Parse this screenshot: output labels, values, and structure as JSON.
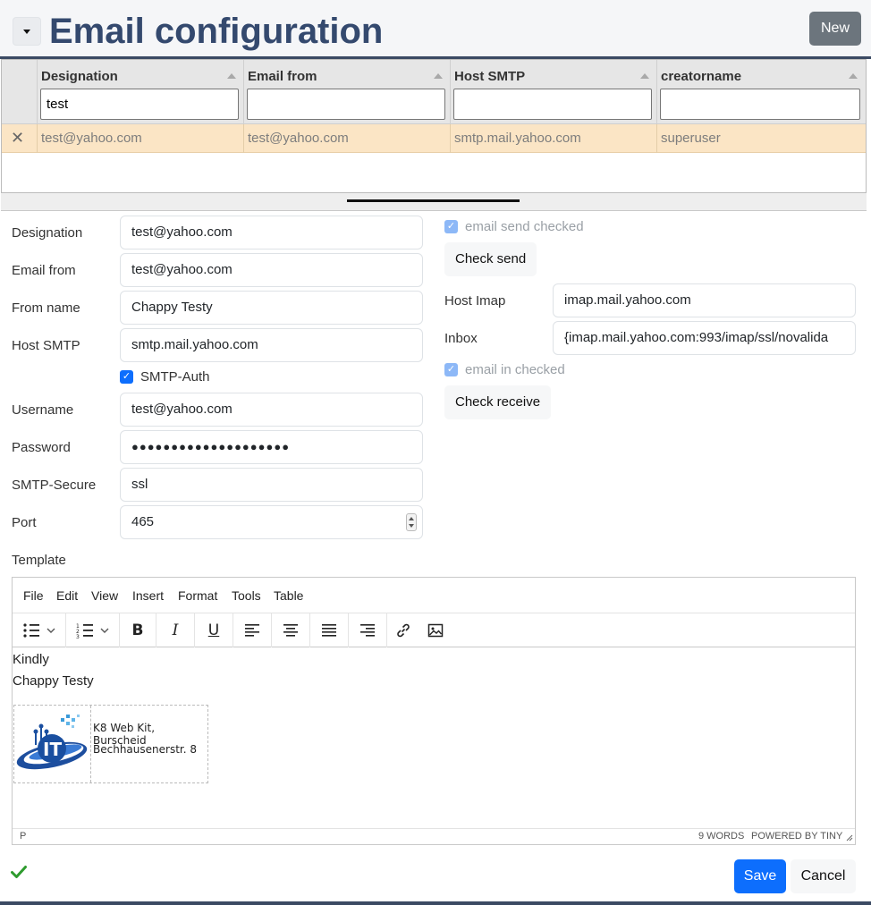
{
  "header": {
    "title": "Email configuration",
    "new_label": "New"
  },
  "grid": {
    "columns": [
      {
        "title": "Designation",
        "filter": "test"
      },
      {
        "title": "Email from",
        "filter": ""
      },
      {
        "title": "Host SMTP",
        "filter": ""
      },
      {
        "title": "creatorname",
        "filter": ""
      }
    ],
    "rows": [
      [
        "test@yahoo.com",
        "test@yahoo.com",
        "smtp.mail.yahoo.com",
        "superuser"
      ]
    ]
  },
  "form": {
    "designation_label": "Designation",
    "designation": "test@yahoo.com",
    "email_from_label": "Email from",
    "email_from": "test@yahoo.com",
    "from_name_label": "From name",
    "from_name": "Chappy Testy",
    "host_smtp_label": "Host SMTP",
    "host_smtp": "smtp.mail.yahoo.com",
    "smtp_auth_label": "SMTP-Auth",
    "username_label": "Username",
    "username": "test@yahoo.com",
    "password_label": "Password",
    "password": "●●●●●●●●●●●●●●●●●●●●",
    "smtp_secure_label": "SMTP-Secure",
    "smtp_secure": "ssl",
    "port_label": "Port",
    "port": "465",
    "email_send_checked_label": "email send checked",
    "check_send_label": "Check send",
    "host_imap_label": "Host Imap",
    "host_imap": "imap.mail.yahoo.com",
    "inbox_label": "Inbox",
    "inbox": "{imap.mail.yahoo.com:993/imap/ssl/novalida",
    "email_in_checked_label": "email in checked",
    "check_receive_label": "Check receive",
    "template_label": "Template"
  },
  "editor": {
    "menu": [
      "File",
      "Edit",
      "View",
      "Insert",
      "Format",
      "Tools",
      "Table"
    ],
    "content_line1": "Kindly",
    "content_line2": "Chappy Testy",
    "sig_line1": "K8 Web Kit, Burscheid",
    "sig_line2": "Bechhausenerstr. 8",
    "logo_text": "IT",
    "status_path": "P",
    "status_words": "9 WORDS",
    "status_powered": "POWERED BY TINY"
  },
  "footer": {
    "save_label": "Save",
    "cancel_label": "Cancel"
  },
  "colors": {
    "title": "#34496e",
    "primary": "#0d6efd",
    "selected_row": "#fbe5c5",
    "secondary": "#6c757d"
  }
}
